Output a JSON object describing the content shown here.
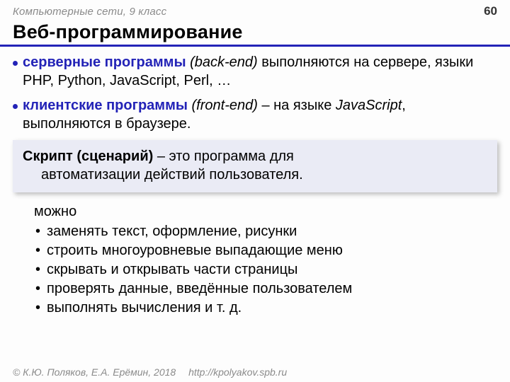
{
  "header": {
    "subject": "Компьютерные сети, 9 класс",
    "page_number": "60"
  },
  "title": "Веб-программирование",
  "bullets": [
    {
      "term": "серверные программы",
      "paren": "(back-end)",
      "rest": " выполняются на сервере, языки PHP, Python, JavaScript, Perl, …"
    },
    {
      "term": "клиентские программы",
      "paren": "(front-end)",
      "rest_pre": " – на языке ",
      "rest_ital": "JavaScript",
      "rest_post": ", выполняются в браузере."
    }
  ],
  "definition": {
    "lead": "Скрипт (сценарий)",
    "body1": " – это программа для",
    "body2": "автоматизации действий пользователя."
  },
  "capabilities": {
    "intro": "можно",
    "items": [
      "заменять текст, оформление, рисунки",
      "строить многоуровневые выпадающие меню",
      "скрывать и открывать части страницы",
      "проверять данные, введённые пользователем",
      "выполнять вычисления и т. д."
    ]
  },
  "footer": {
    "authors": "© К.Ю. Поляков, Е.А. Ерёмин, 2018",
    "url": "http://kpolyakov.spb.ru"
  }
}
